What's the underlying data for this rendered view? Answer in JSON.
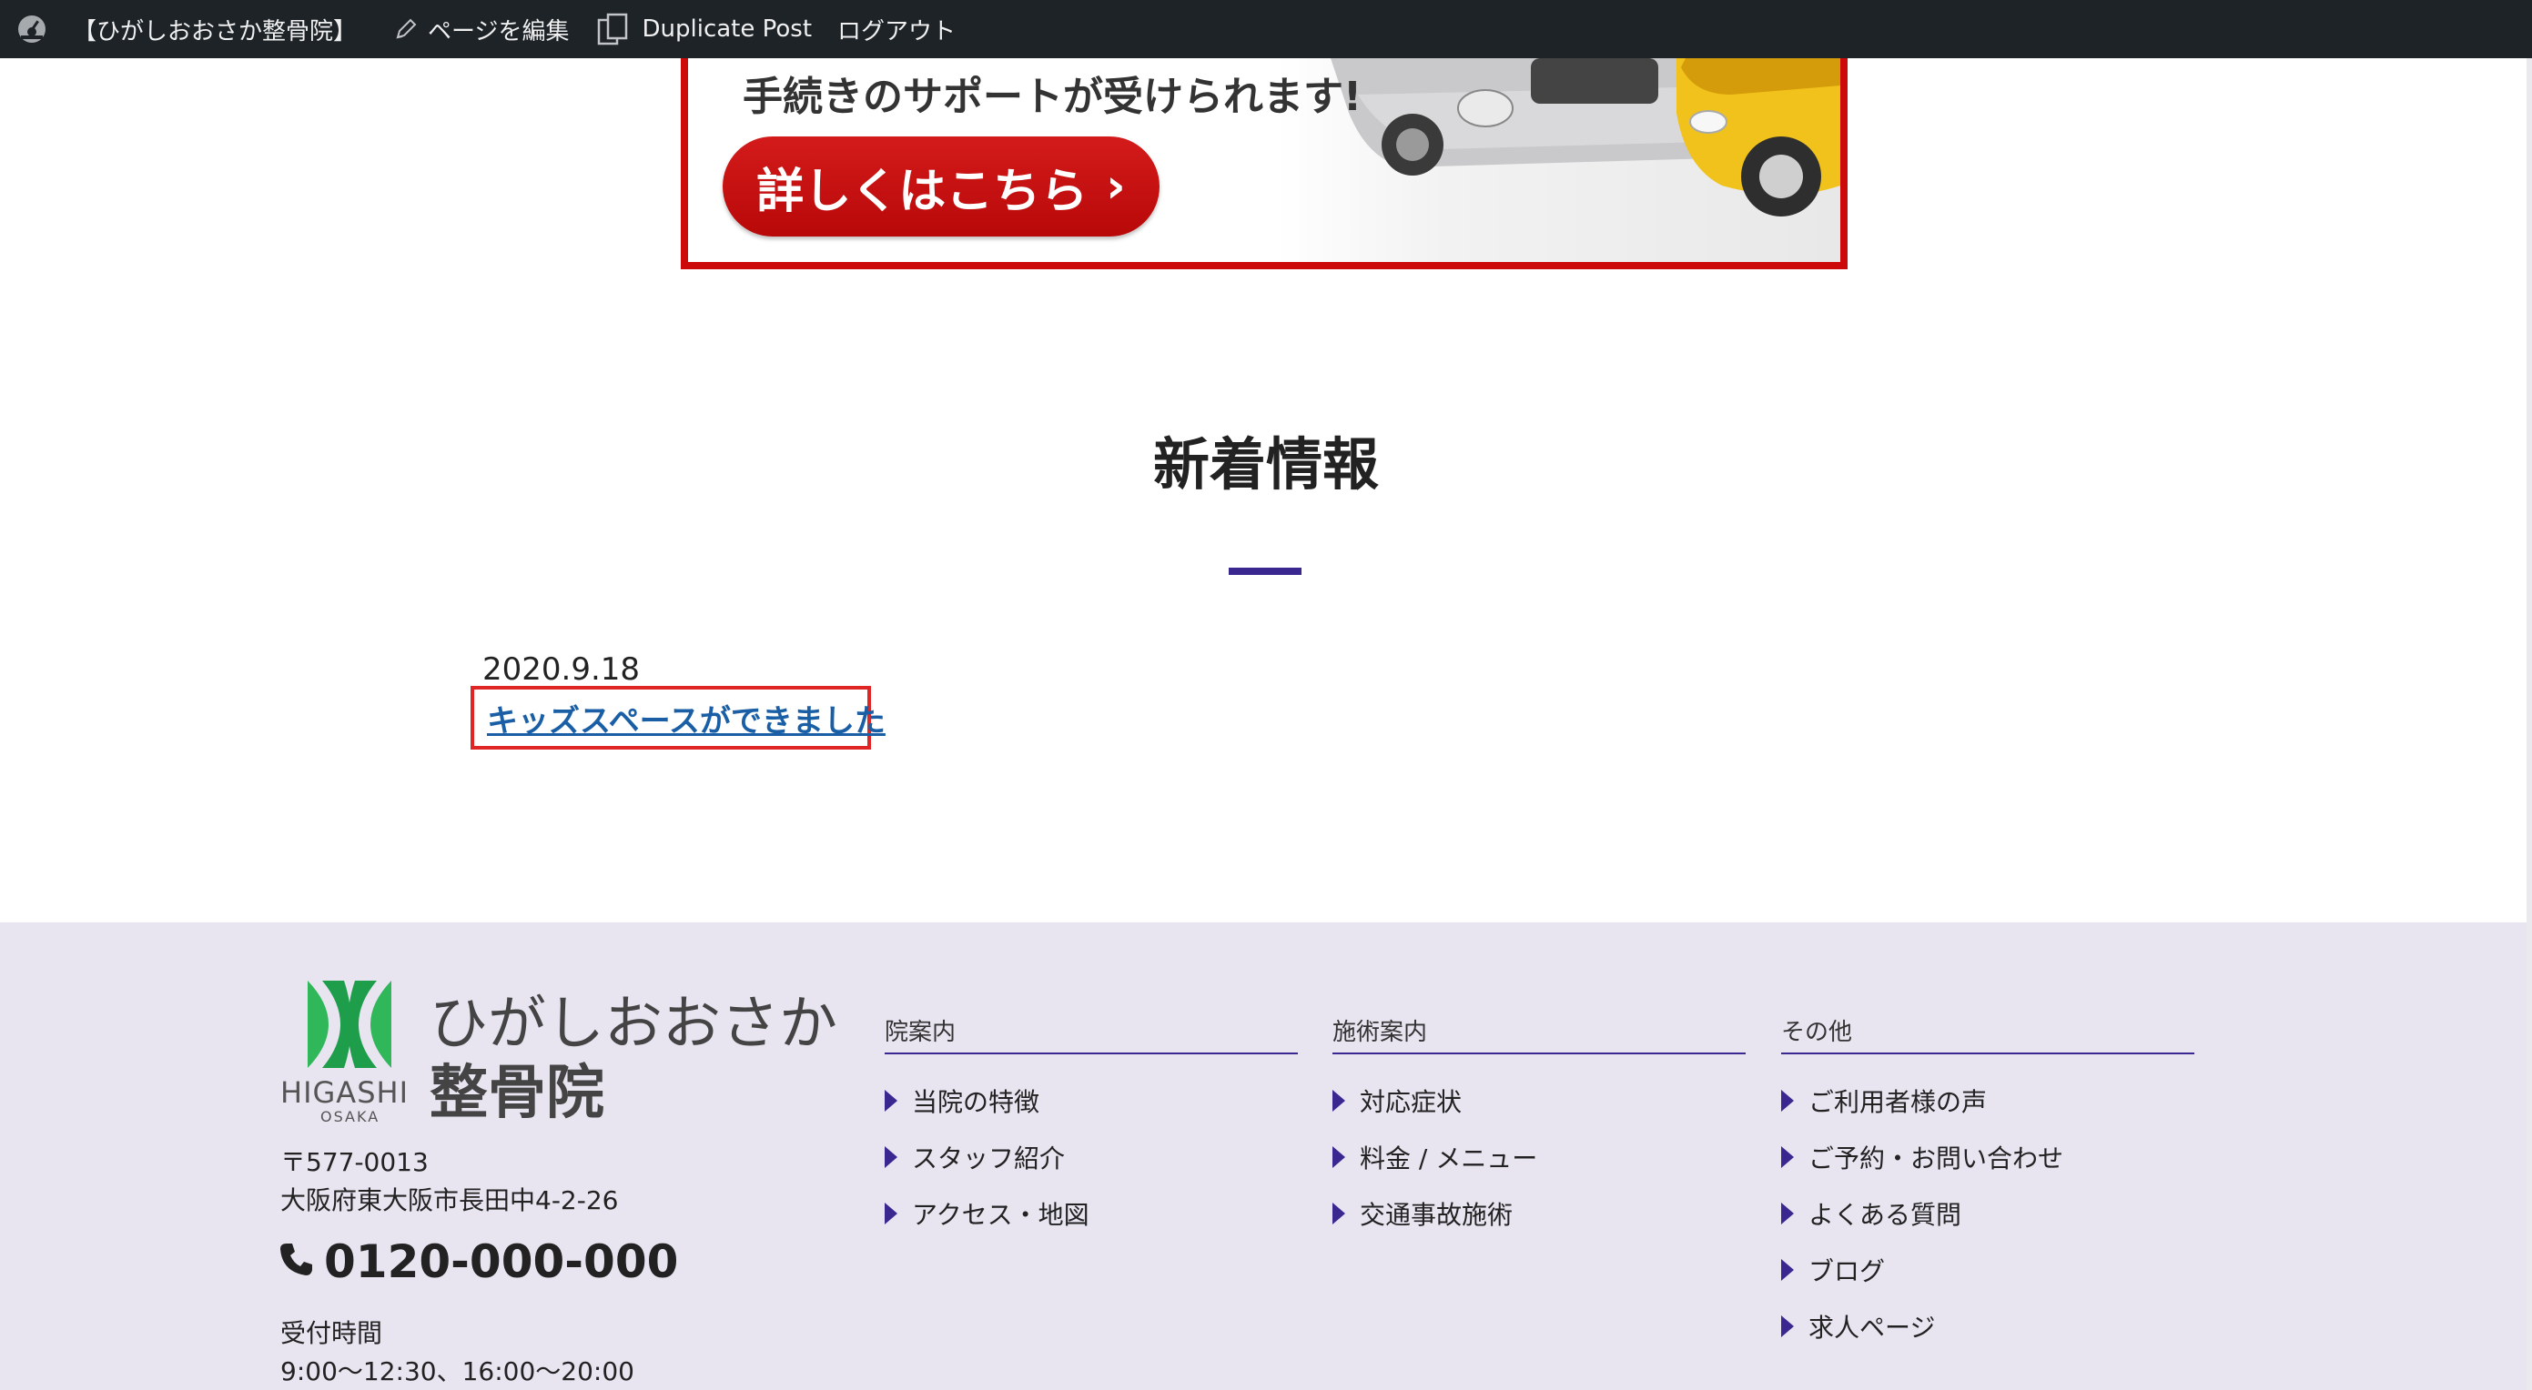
{
  "admin_bar": {
    "site_name": "【ひがしおおさか整骨院】",
    "edit_page": "ページを編集",
    "duplicate_post": "Duplicate Post",
    "logout": "ログアウト"
  },
  "banner": {
    "text": "手続きのサポートが受けられます!",
    "button_label": "詳しくはこちら",
    "button_arrow": "›",
    "accent": "#cc0a0a"
  },
  "news": {
    "title": "新着情報",
    "items": [
      {
        "date": "2020.9.18",
        "title": "キッズスペースができました"
      }
    ],
    "accent": "#3a2890"
  },
  "footer": {
    "logo": {
      "mark_text": "HIGASHI",
      "mark_sub": "OSAKA",
      "name_line1": "ひがしおおさか",
      "name_line2": "整骨院"
    },
    "postal": "〒577-0013",
    "address": "大阪府東大阪市長田中4-2-26",
    "phone": "0120-000-000",
    "hours_label": "受付時間",
    "hours": "9:00〜12:30、16:00〜20:00",
    "columns": [
      {
        "title": "院案内",
        "items": [
          "当院の特徴",
          "スタッフ紹介",
          "アクセス・地図"
        ]
      },
      {
        "title": "施術案内",
        "items": [
          "対応症状",
          "料金 / メニュー",
          "交通事故施術"
        ]
      },
      {
        "title": "その他",
        "items": [
          "ご利用者様の声",
          "ご予約・お問い合わせ",
          "よくある質問",
          "ブログ",
          "求人ページ"
        ]
      }
    ],
    "background": "#e8e5f1"
  }
}
